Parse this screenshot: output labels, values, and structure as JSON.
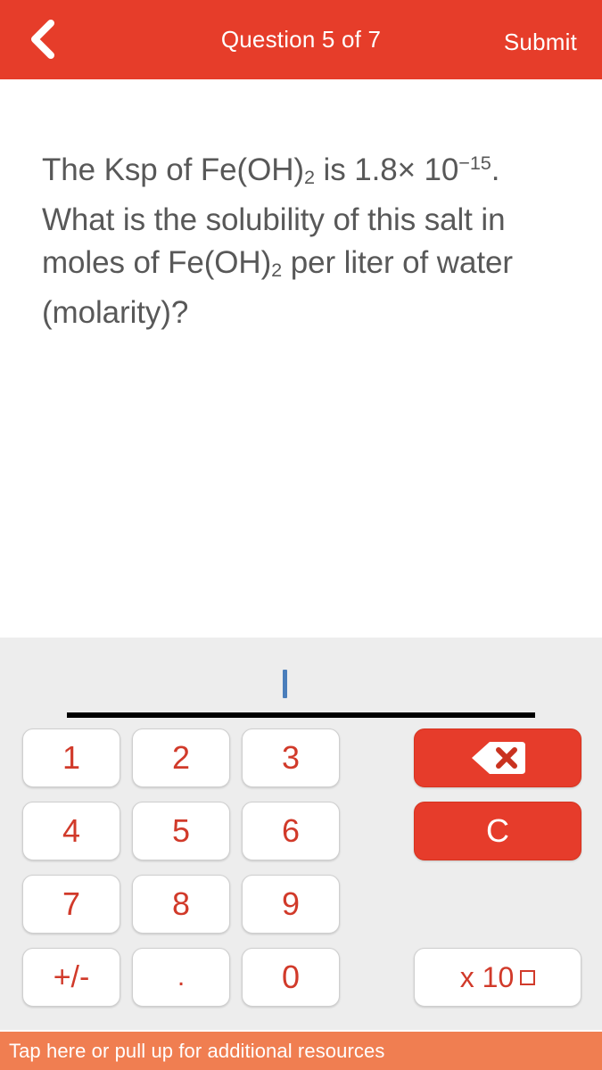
{
  "header": {
    "back_icon": "chevron-left-icon",
    "title": "Question 5 of 7",
    "submit_label": "Submit",
    "background_color": "#e63d2a",
    "text_color": "#ffffff"
  },
  "question": {
    "text": "The Ksp of Fe(OH)2 is 1.8× 10-15. What is the solubility of this salt in moles of Fe(OH)2 per liter of water (molarity)?",
    "line1_a": "The Ksp of Fe(OH)",
    "line1_sub1": "2",
    "line1_b": " is 1.8× 10",
    "line1_sup": "−15",
    "line1_c": ".",
    "line2": "What is the solubility of this salt in",
    "line3_a": "moles of Fe(OH)",
    "line3_sub": "2",
    "line3_b": " per liter of water",
    "line4": "(molarity)?",
    "text_color": "#585858"
  },
  "keypad": {
    "background_color": "#ededed",
    "input": {
      "value": "",
      "cursor_color": "#4a7ebb",
      "underline_color": "#000000"
    },
    "keys": [
      {
        "name": "key-1",
        "label": "1",
        "type": "number"
      },
      {
        "name": "key-2",
        "label": "2",
        "type": "number"
      },
      {
        "name": "key-3",
        "label": "3",
        "type": "number"
      },
      {
        "name": "key-4",
        "label": "4",
        "type": "number"
      },
      {
        "name": "key-5",
        "label": "5",
        "type": "number"
      },
      {
        "name": "key-6",
        "label": "6",
        "type": "number"
      },
      {
        "name": "key-7",
        "label": "7",
        "type": "number"
      },
      {
        "name": "key-8",
        "label": "8",
        "type": "number"
      },
      {
        "name": "key-9",
        "label": "9",
        "type": "number"
      },
      {
        "name": "key-plus-minus",
        "label": "+/-",
        "type": "sign"
      },
      {
        "name": "key-decimal",
        "label": ".",
        "type": "decimal"
      },
      {
        "name": "key-0",
        "label": "0",
        "type": "number"
      }
    ],
    "backspace": {
      "icon": "backspace-icon",
      "background_color": "#e63c2b"
    },
    "clear": {
      "label": "C",
      "background_color": "#e63c2b",
      "text_color": "#ffffff"
    },
    "exponent": {
      "label": "x 10",
      "placeholder_icon": "empty-square-exponent",
      "text_color": "#d13a2a"
    },
    "key_text_color": "#d13a2a",
    "key_background_color": "#ffffff"
  },
  "footer": {
    "text": "Tap here or pull up for additional resources",
    "background_color": "#f07e51",
    "text_color": "#ffffff"
  }
}
